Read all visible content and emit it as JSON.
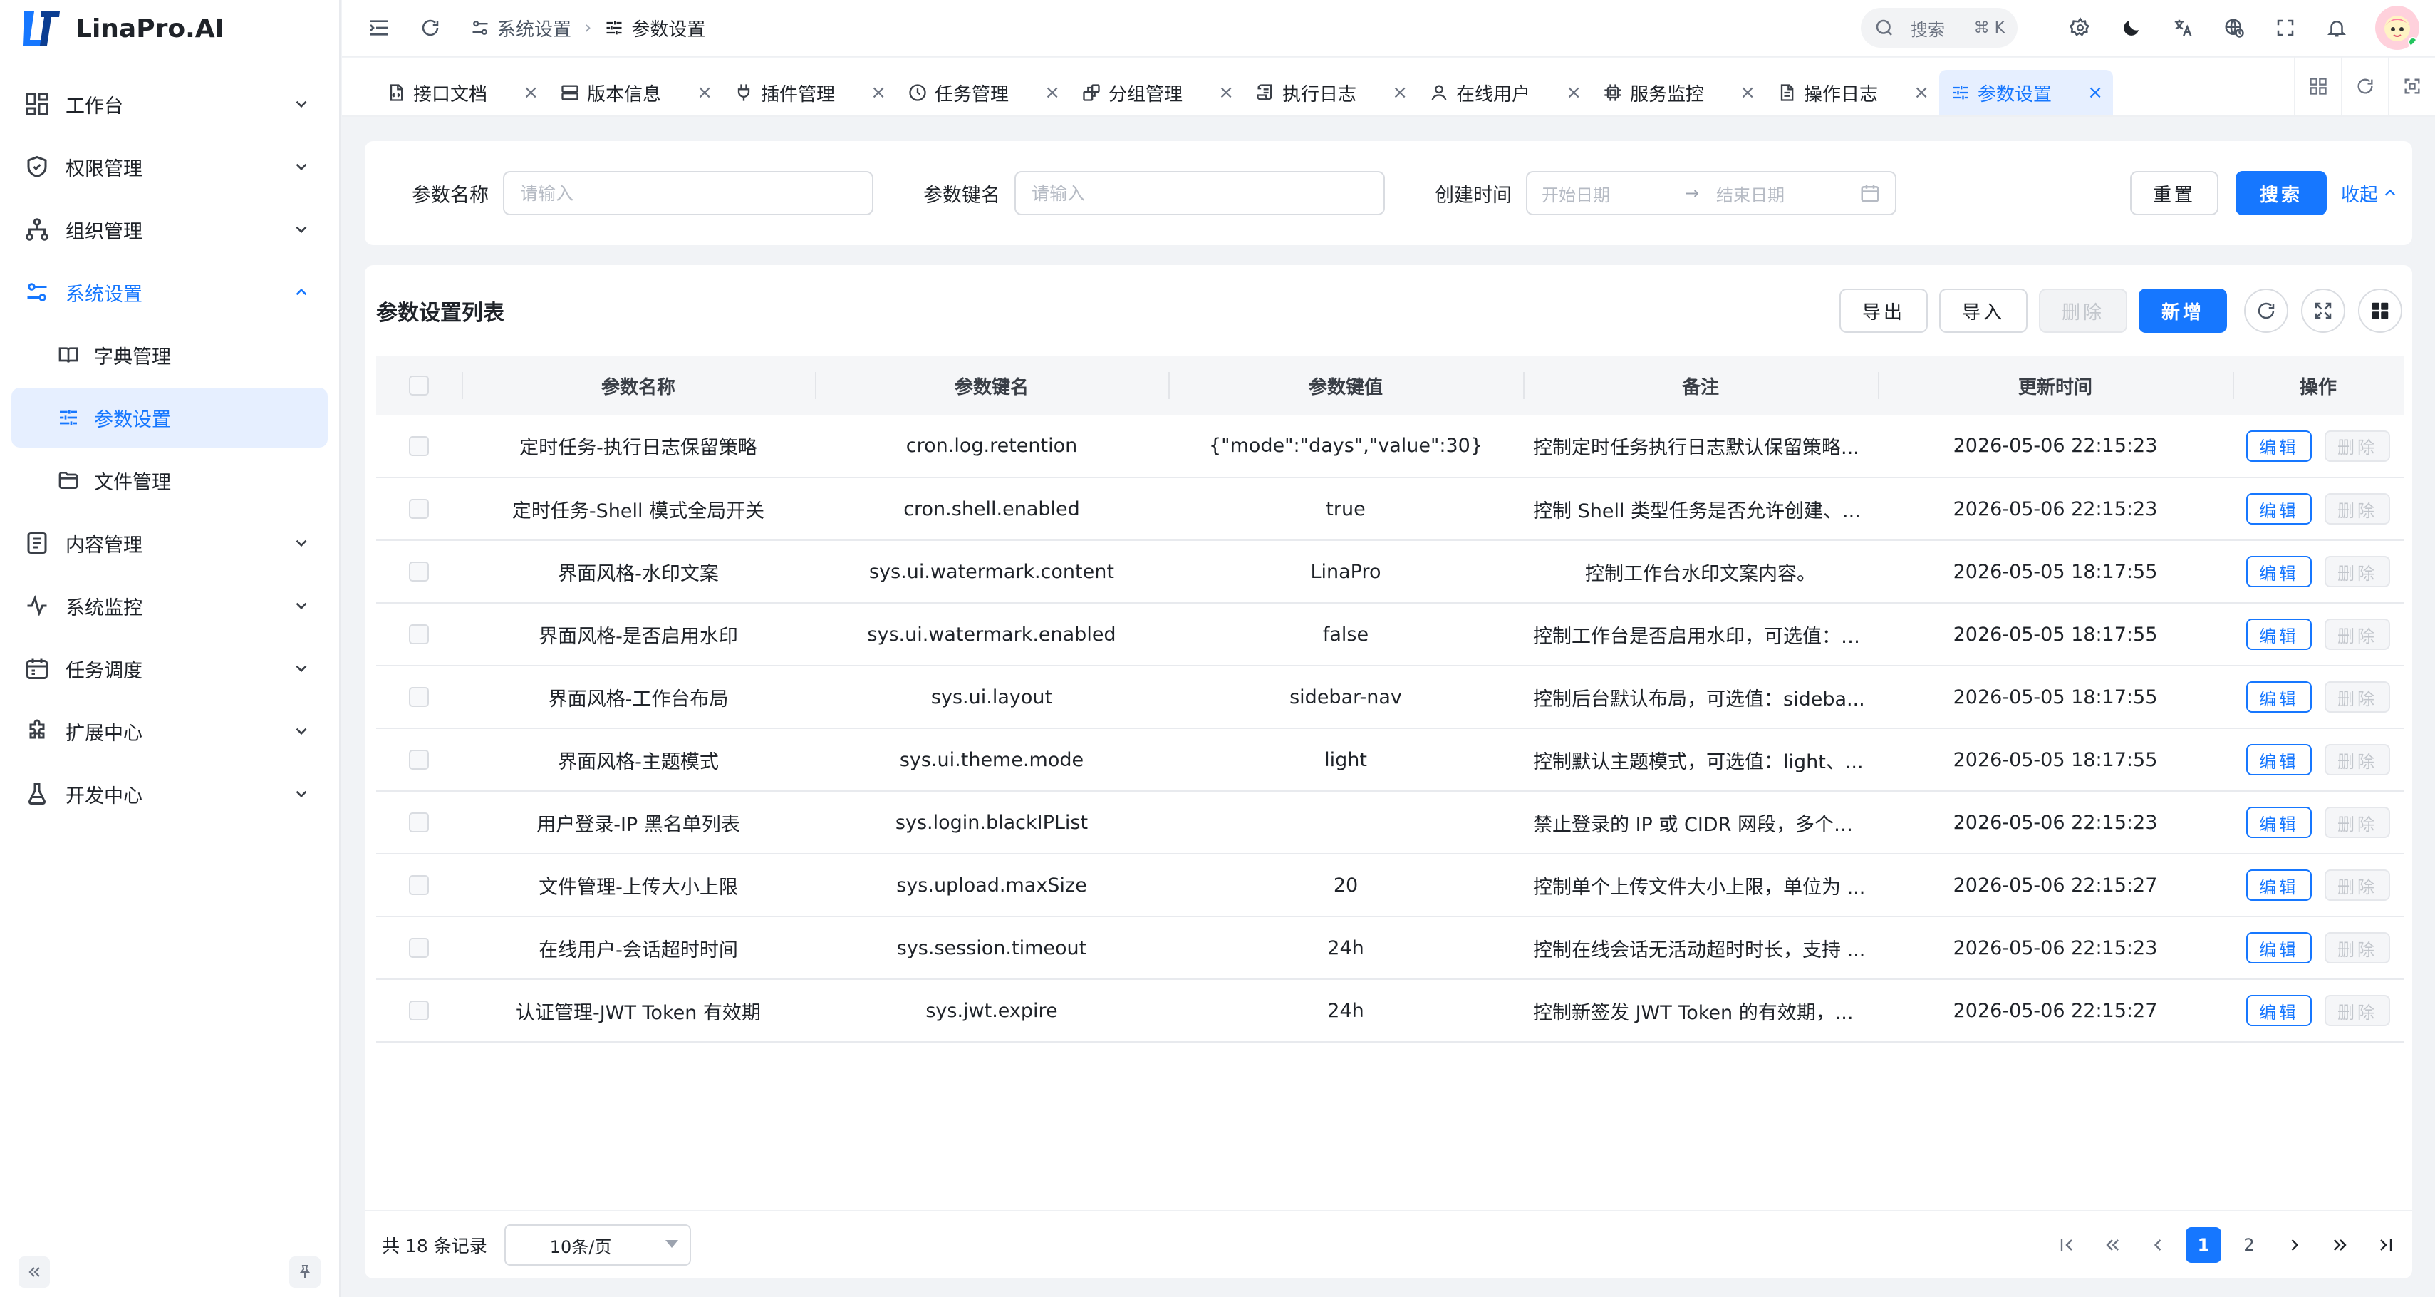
{
  "brand": {
    "name": "LinaPro.AI"
  },
  "sidebar": {
    "items": [
      {
        "label": "工作台",
        "icon": "dashboard-icon"
      },
      {
        "label": "权限管理",
        "icon": "shield-icon"
      },
      {
        "label": "组织管理",
        "icon": "org-tree-icon"
      },
      {
        "label": "系统设置",
        "icon": "settings-sliders-icon",
        "open": true,
        "children": [
          {
            "label": "字典管理",
            "icon": "book-icon"
          },
          {
            "label": "参数设置",
            "icon": "sliders-icon",
            "active": true
          },
          {
            "label": "文件管理",
            "icon": "folder-icon"
          }
        ]
      },
      {
        "label": "内容管理",
        "icon": "document-icon"
      },
      {
        "label": "系统监控",
        "icon": "pulse-icon"
      },
      {
        "label": "任务调度",
        "icon": "calendar-icon"
      },
      {
        "label": "扩展中心",
        "icon": "puzzle-icon"
      },
      {
        "label": "开发中心",
        "icon": "flask-icon"
      }
    ]
  },
  "header": {
    "breadcrumb": [
      "系统设置",
      "参数设置"
    ],
    "search_label": "搜索",
    "search_shortcut": "⌘ K"
  },
  "tabs": [
    {
      "label": "接口文档",
      "icon": "api-doc-icon"
    },
    {
      "label": "版本信息",
      "icon": "server-icon"
    },
    {
      "label": "插件管理",
      "icon": "plug-icon"
    },
    {
      "label": "任务管理",
      "icon": "clock-icon"
    },
    {
      "label": "分组管理",
      "icon": "group-icon"
    },
    {
      "label": "执行日志",
      "icon": "scroll-icon"
    },
    {
      "label": "在线用户",
      "icon": "user-icon"
    },
    {
      "label": "服务监控",
      "icon": "cpu-icon"
    },
    {
      "label": "操作日志",
      "icon": "file-text-icon"
    },
    {
      "label": "参数设置",
      "icon": "sliders-icon",
      "active": true
    }
  ],
  "filter": {
    "name_label": "参数名称",
    "name_placeholder": "请输入",
    "key_label": "参数键名",
    "key_placeholder": "请输入",
    "time_label": "创建时间",
    "start_placeholder": "开始日期",
    "end_placeholder": "结束日期",
    "reset_label": "重置",
    "search_label": "搜索",
    "collapse_label": "收起"
  },
  "table": {
    "title": "参数设置列表",
    "actions": {
      "export": "导出",
      "import": "导入",
      "delete": "删除",
      "add": "新增"
    },
    "columns": [
      "参数名称",
      "参数键名",
      "参数键值",
      "备注",
      "更新时间",
      "操作"
    ],
    "edit_label": "编辑",
    "delete_label": "删除",
    "rows": [
      {
        "name": "定时任务-执行日志保留策略",
        "key": "cron.log.retention",
        "value": "{\"mode\":\"days\",\"value\":30}",
        "remark": "控制定时任务执行日志默认保留策略...",
        "updated": "2026-05-06 22:15:23"
      },
      {
        "name": "定时任务-Shell 模式全局开关",
        "key": "cron.shell.enabled",
        "value": "true",
        "remark": "控制 Shell 类型任务是否允许创建、...",
        "updated": "2026-05-06 22:15:23"
      },
      {
        "name": "界面风格-水印文案",
        "key": "sys.ui.watermark.content",
        "value": "LinaPro",
        "remark": "控制工作台水印文案内容。",
        "updated": "2026-05-05 18:17:55",
        "center": true
      },
      {
        "name": "界面风格-是否启用水印",
        "key": "sys.ui.watermark.enabled",
        "value": "false",
        "remark": "控制工作台是否启用水印，可选值：t...",
        "updated": "2026-05-05 18:17:55"
      },
      {
        "name": "界面风格-工作台布局",
        "key": "sys.ui.layout",
        "value": "sidebar-nav",
        "remark": "控制后台默认布局，可选值：sideba...",
        "updated": "2026-05-05 18:17:55"
      },
      {
        "name": "界面风格-主题模式",
        "key": "sys.ui.theme.mode",
        "value": "light",
        "remark": "控制默认主题模式，可选值：light、...",
        "updated": "2026-05-05 18:17:55"
      },
      {
        "name": "用户登录-IP 黑名单列表",
        "key": "sys.login.blackIPList",
        "value": "",
        "remark": "禁止登录的 IP 或 CIDR 网段，多个值...",
        "updated": "2026-05-06 22:15:23"
      },
      {
        "name": "文件管理-上传大小上限",
        "key": "sys.upload.maxSize",
        "value": "20",
        "remark": "控制单个上传文件大小上限，单位为 ...",
        "updated": "2026-05-06 22:15:27"
      },
      {
        "name": "在线用户-会话超时时间",
        "key": "sys.session.timeout",
        "value": "24h",
        "remark": "控制在线会话无活动超时时长，支持 ...",
        "updated": "2026-05-06 22:15:23"
      },
      {
        "name": "认证管理-JWT Token 有效期",
        "key": "sys.jwt.expire",
        "value": "24h",
        "remark": "控制新签发 JWT Token 的有效期，...",
        "updated": "2026-05-06 22:15:27"
      }
    ]
  },
  "pagination": {
    "total_text": "共 18 条记录",
    "page_size": "10条/页",
    "pages": [
      "1",
      "2"
    ],
    "current": "1"
  },
  "colors": {
    "primary": "#1677ff",
    "active_bg": "#e6efff"
  }
}
